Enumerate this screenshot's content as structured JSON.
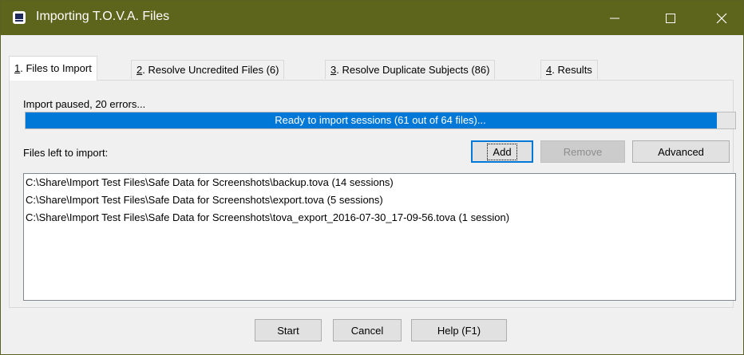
{
  "window": {
    "title": "Importing T.O.V.A. Files",
    "title_bar_color": "#5d651d",
    "icons": [
      "app-icon",
      "minimize-icon",
      "maximize-icon",
      "close-icon"
    ]
  },
  "tabs": [
    {
      "key": "1",
      "label": ". Files to Import",
      "active": true
    },
    {
      "key": "2",
      "label": ". Resolve Uncredited Files (6)",
      "active": false
    },
    {
      "key": "3",
      "label": ". Resolve Duplicate Subjects (86)",
      "active": false
    },
    {
      "key": "4",
      "label": ". Results",
      "active": false
    }
  ],
  "status": {
    "text": "Import paused, 20 errors...",
    "progress_label": "Ready to import sessions (61 out of 64 files)...",
    "progress_fraction": 0.974,
    "progress_color": "#0078d7"
  },
  "files": {
    "label": "Files left to import:",
    "items": [
      "C:\\Share\\Import Test Files\\Safe Data for Screenshots\\backup.tova (14 sessions)",
      "C:\\Share\\Import Test Files\\Safe Data for Screenshots\\export.tova (5 sessions)",
      "C:\\Share\\Import Test Files\\Safe Data for Screenshots\\tova_export_2016-07-30_17-09-56.tova (1 session)"
    ]
  },
  "buttons": {
    "add": "Add",
    "remove": "Remove",
    "advanced": "Advanced",
    "start": "Start",
    "cancel": "Cancel",
    "help": "Help (F1)"
  }
}
